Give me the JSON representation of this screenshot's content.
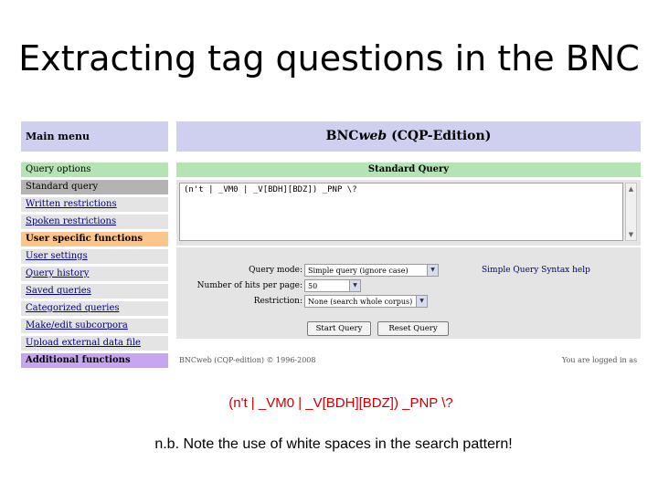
{
  "slide": {
    "title": "Extracting tag questions in the BNC",
    "pattern": "(n't | _VM0 | _V[BDH][BDZ]) _PNP \\?",
    "note": "n.b. Note the use of white spaces in the search pattern!"
  },
  "sidebar": {
    "main_menu": "Main menu",
    "items": [
      {
        "label": "Query options"
      },
      {
        "label": "Standard query"
      },
      {
        "label": "Written restrictions"
      },
      {
        "label": "Spoken restrictions"
      },
      {
        "label": "User specific functions"
      },
      {
        "label": "User settings"
      },
      {
        "label": "Query history"
      },
      {
        "label": "Saved queries"
      },
      {
        "label": "Categorized queries"
      },
      {
        "label": "Make/edit subcorpora"
      },
      {
        "label": "Upload external data file"
      },
      {
        "label": "Additional functions"
      }
    ]
  },
  "header": {
    "brand_bnc": "BNC",
    "brand_web": "web",
    "brand_rest": " (CQP-Edition)",
    "section": "Standard Query"
  },
  "query": {
    "text": "(n't | _VM0 | _V[BDH][BDZ]) _PNP \\?",
    "scroll_up": "▲",
    "scroll_down": "▼"
  },
  "options": {
    "mode_label": "Query mode:",
    "mode_value": "Simple query (ignore case)",
    "hits_label": "Number of hits per page:",
    "hits_value": "50",
    "restriction_label": "Restriction:",
    "restriction_value": "None (search whole corpus)",
    "help_link": "Simple Query Syntax help",
    "dropdown_arrow": "▼",
    "start_button": "Start Query",
    "reset_button": "Reset Query"
  },
  "footer": {
    "copyright": "BNCweb (CQP-edition) © 1996-2008",
    "login": "You are logged in as"
  }
}
